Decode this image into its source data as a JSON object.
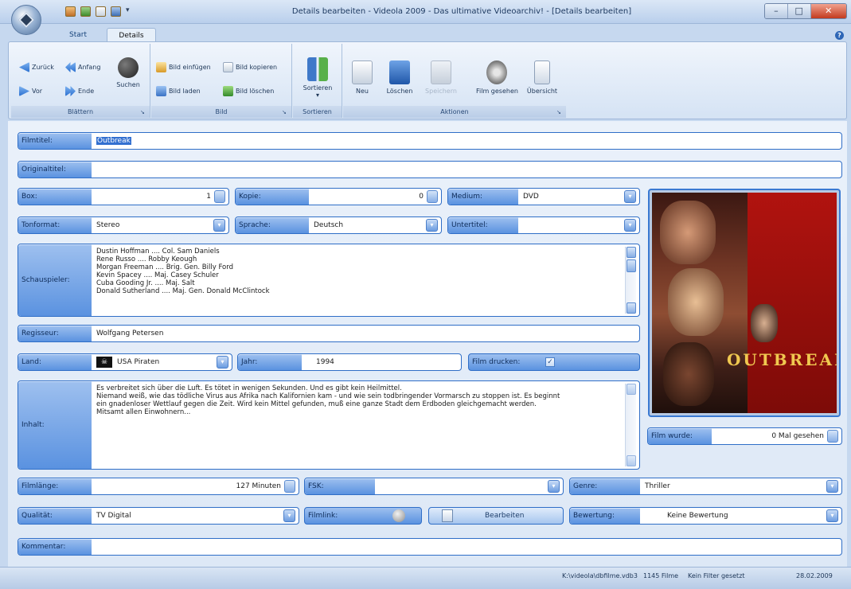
{
  "window": {
    "title": "Details bearbeiten - Videola 2009 - Das ultimative Videoarchiv! - [Details bearbeiten]"
  },
  "tabs": [
    {
      "label": "Start"
    },
    {
      "label": "Details"
    }
  ],
  "ribbon": {
    "blaettern": {
      "label": "Blättern",
      "zurueck": "Zurück",
      "anfang": "Anfang",
      "vor": "Vor",
      "ende": "Ende",
      "suchen": "Suchen"
    },
    "bild": {
      "label": "Bild",
      "einfuegen": "Bild einfügen",
      "kopieren": "Bild kopieren",
      "laden": "Bild laden",
      "loeschen": "Bild löschen"
    },
    "sortieren": {
      "label": "Sortieren",
      "button": "Sortieren"
    },
    "aktionen": {
      "label": "Aktionen",
      "neu": "Neu",
      "loeschen": "Löschen",
      "speichern": "Speichern",
      "film_gesehen": "Film gesehen",
      "uebersicht": "Übersicht"
    }
  },
  "form": {
    "filmtitel": {
      "label": "Filmtitel:",
      "value": "Outbreak"
    },
    "originaltitel": {
      "label": "Originaltitel:",
      "value": ""
    },
    "box": {
      "label": "Box:",
      "value": "1"
    },
    "kopie": {
      "label": "Kopie:",
      "value": "0"
    },
    "medium": {
      "label": "Medium:",
      "value": "DVD"
    },
    "tonformat": {
      "label": "Tonformat:",
      "value": "Stereo"
    },
    "sprache": {
      "label": "Sprache:",
      "value": "Deutsch"
    },
    "untertitel": {
      "label": "Untertitel:",
      "value": ""
    },
    "schauspieler": {
      "label": "Schauspieler:",
      "lines": [
        "Dustin Hoffman .... Col. Sam Daniels",
        "Rene Russo .... Robby Keough",
        "Morgan Freeman .... Brig. Gen. Billy Ford",
        "Kevin Spacey .... Maj. Casey Schuler",
        "Cuba Gooding Jr. .... Maj. Salt",
        "Donald Sutherland .... Maj. Gen. Donald McClintock"
      ]
    },
    "regisseur": {
      "label": "Regisseur:",
      "value": "Wolfgang Petersen"
    },
    "land": {
      "label": "Land:",
      "value": "USA Piraten"
    },
    "jahr": {
      "label": "Jahr:",
      "value": "1994"
    },
    "film_drucken": {
      "label": "Film drucken:",
      "checked": true
    },
    "inhalt": {
      "label": "Inhalt:",
      "lines": [
        "Es verbreitet sich über die Luft. Es tötet in wenigen Sekunden. Und es gibt kein Heilmittel.",
        "Niemand weiß, wie das tödliche Virus aus Afrika nach Kalifornien kam - und wie sein todbringender Vormarsch zu stoppen ist. Es beginnt",
        "ein gnadenloser Wettlauf gegen die Zeit. Wird kein Mittel gefunden, muß eine ganze Stadt dem Erdboden gleichgemacht werden.",
        "Mitsamt allen Einwohnern..."
      ]
    },
    "film_wurde": {
      "label": "Film wurde:",
      "value": "0 Mal gesehen"
    },
    "filmlaenge": {
      "label": "Filmlänge:",
      "value": "127 Minuten"
    },
    "fsk": {
      "label": "FSK:",
      "value": ""
    },
    "genre": {
      "label": "Genre:",
      "value": "Thriller"
    },
    "qualitaet": {
      "label": "Qualität:",
      "value": "TV Digital"
    },
    "filmlink": {
      "label": "Filmlink:"
    },
    "bearbeiten": {
      "label": "Bearbeiten"
    },
    "bewertung": {
      "label": "Bewertung:",
      "value": "Keine Bewertung"
    },
    "kommentar": {
      "label": "Kommentar:",
      "value": ""
    }
  },
  "poster": {
    "title_text": "OUTBREAK"
  },
  "status": {
    "path": "K:\\videola\\dbfilme.vdb3",
    "count": "1145 Filme",
    "filter": "Kein Filter gesetzt",
    "date": "28.02.2009"
  },
  "colors": {
    "field_border": "#2f6ec7",
    "label_bg": "#5a92e0",
    "ribbon_bg": "#dde8f6"
  }
}
